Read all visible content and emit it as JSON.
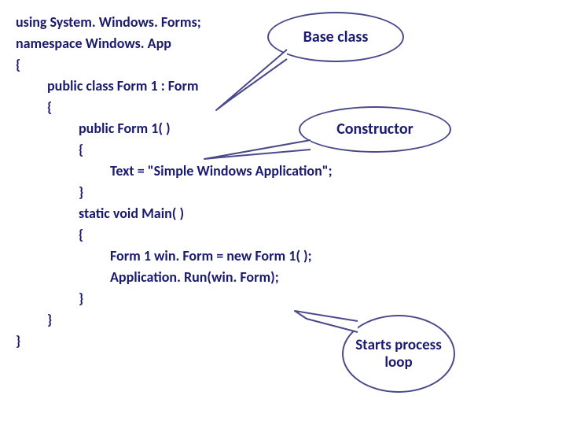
{
  "code": {
    "l1": "using System. Windows. Forms;",
    "l2": "namespace Windows. App",
    "l3": "{",
    "l4": "public class Form 1 : Form",
    "l5": "{",
    "l6": "public Form 1( )",
    "l7": "{",
    "l8": "Text = \"Simple Windows Application\";",
    "l9": "}",
    "l10": "static void Main( )",
    "l11": "{",
    "l12": "Form 1 win. Form = new Form 1( );",
    "l13": "Application. Run(win. Form);",
    "l14": "}",
    "l15": "}",
    "l16": "}"
  },
  "callouts": {
    "base": "Base class",
    "ctor": "Constructor",
    "loop": "Starts process loop"
  }
}
